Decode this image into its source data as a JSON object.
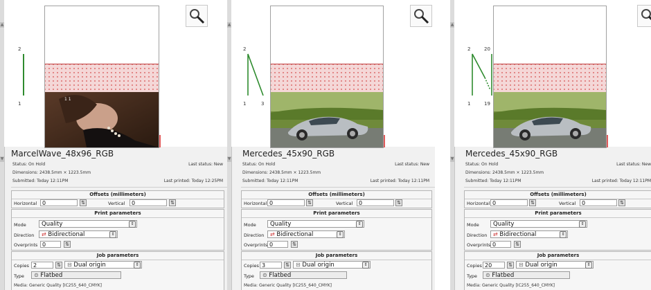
{
  "zoom_icon": "magnifier-icon",
  "photos": {
    "portrait": "woman-portrait-photo",
    "car": "silver-car-photo"
  },
  "colors": {
    "hatch": "#d23c3c",
    "path_line": "#2e8b2e",
    "panel_bg": "#f1f1f1"
  },
  "labels": {
    "offsets_title": "Offsets (millimeters)",
    "horizontal": "Horizontal",
    "vertical": "Vertical",
    "print_title": "Print parameters",
    "mode": "Mode",
    "direction": "Direction",
    "overprints": "Overprints",
    "job_title": "Job parameters",
    "copies": "Copies",
    "type": "Type"
  },
  "panels": [
    {
      "name": "MarcelWave_48x96_RGB",
      "status": "Status: On Hold",
      "last_status": "Last status: New",
      "dimensions": "Dimensions: 2438.5mm × 1223.5mm",
      "submitted": "Submitted: Today 12:11PM",
      "last_printed": "Last printed: Today 12:25PM",
      "path_labels": {
        "top_left": "2",
        "bottom_left": "1",
        "bottom_right": "",
        "top_right": ""
      },
      "horizontal": "0",
      "vertical": "0",
      "mode": "Quality",
      "direction": "Bidirectional",
      "overprints": "0",
      "copies": "2",
      "origin": "Dual origin",
      "type": "Flatbed",
      "media": "Media: Generic Quality [IC255_640_CMYK]"
    },
    {
      "name": "Mercedes_45x90_RGB",
      "status": "Status: On Hold",
      "last_status": "Last status: New",
      "dimensions": "Dimensions: 2438.5mm × 1223.5mm",
      "submitted": "Submitted: Today 12:11PM",
      "last_printed": "Last printed: Today 12:11PM",
      "path_labels": {
        "top_left": "2",
        "bottom_left": "1",
        "bottom_right": "3",
        "top_right": ""
      },
      "horizontal": "0",
      "vertical": "0",
      "mode": "Quality",
      "direction": "Bidirectional",
      "overprints": "0",
      "copies": "3",
      "origin": "Dual origin",
      "type": "Flatbed",
      "media": "Media: Generic Quality [IC255_640_CMYK]"
    },
    {
      "name": "Mercedes_45x90_RGB",
      "status": "Status: On Hold",
      "last_status": "Last status: New",
      "dimensions": "Dimensions: 2438.5mm × 1223.5mm",
      "submitted": "Submitted: Today 12:11PM",
      "last_printed": "Last printed: Today 12:11PM",
      "path_labels": {
        "top_left": "2",
        "bottom_left": "1",
        "bottom_right": "19",
        "top_right": "20"
      },
      "horizontal": "0",
      "vertical": "0",
      "mode": "Quality",
      "direction": "Bidirectional",
      "overprints": "0",
      "copies": "20",
      "origin": "Dual origin",
      "type": "Flatbed",
      "media": "Media: Generic Quality [IC255_640_CMYK]"
    }
  ]
}
